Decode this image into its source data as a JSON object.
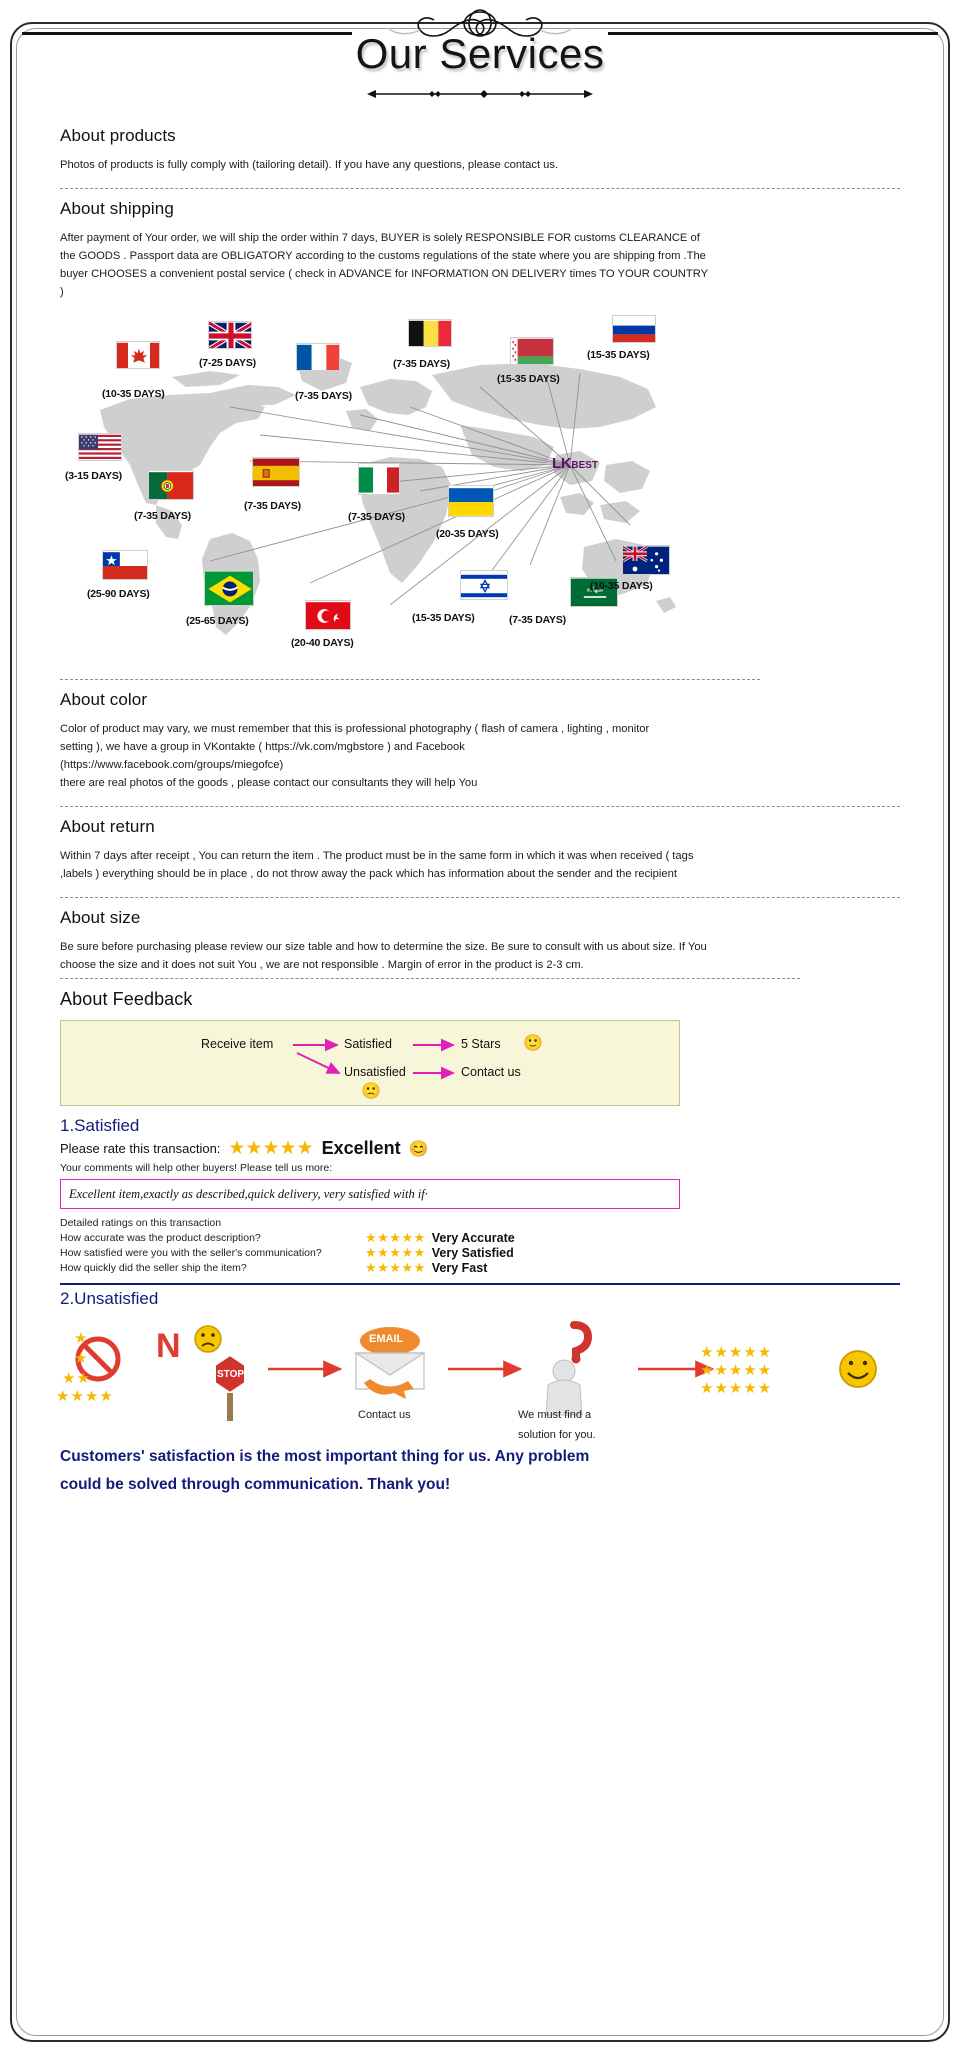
{
  "header": {
    "title": "Our Services",
    "flourish_icon": "ornamental-flourish-icon",
    "underline_icon": "decorative-divider-icon"
  },
  "sections": {
    "products": {
      "heading": "About products",
      "body": "Photos of products is fully comply with (tailoring detail). If you have any questions, please contact us."
    },
    "shipping": {
      "heading": "About shipping",
      "body": "After payment of Your order, we will ship the order within 7 days, BUYER is solely RESPONSIBLE FOR customs CLEARANCE of the GOODS . Passport data are OBLIGATORY according to the customs regulations of the state where you are shipping from .The buyer CHOOSES a convenient postal service ( check in ADVANCE for INFORMATION ON DELIVERY times TO YOUR COUNTRY )"
    },
    "color": {
      "heading": "About color",
      "body_line1": "Color of product may vary, we must remember that this is professional photography ( flash of camera , lighting , monitor",
      "body_line2": "setting ), we have a group in VKontakte ( https://vk.com/mgbstore ) and Facebook",
      "body_line3": "(https://www.facebook.com/groups/miegofce)",
      "body_line4": " there are real photos of the goods , please contact our consultants they will help You"
    },
    "return": {
      "heading": "About return",
      "body": "Within 7 days after receipt , You can return the item . The product must be in the same form in which it was when received ( tags ,labels ) everything should be in place , do not throw away the pack which has information about the sender and the recipient"
    },
    "size": {
      "heading": "About size",
      "body": "Be sure before purchasing  please review our size table and how to determine the size. Be sure to consult with us about size. If You choose the size and it does not suit You , we are not responsible . Margin of error in the product is 2-3 cm."
    },
    "feedback": {
      "heading": "About Feedback"
    }
  },
  "map": {
    "hub_label_main": "LK",
    "hub_label_sub": "BEST",
    "destinations": [
      {
        "country": "United Kingdom",
        "flag": "uk-flag",
        "days": "(7-25 DAYS)"
      },
      {
        "country": "Canada",
        "flag": "canada-flag",
        "days": "(10-35 DAYS)"
      },
      {
        "country": "France",
        "flag": "france-flag",
        "days": "(7-35 DAYS)"
      },
      {
        "country": "Belgium",
        "flag": "belgium-flag",
        "days": "(7-35 DAYS)"
      },
      {
        "country": "Belarus",
        "flag": "belarus-flag",
        "days": "(15-35 DAYS)"
      },
      {
        "country": "Russia",
        "flag": "russia-flag",
        "days": "(15-35 DAYS)"
      },
      {
        "country": "United States",
        "flag": "usa-flag",
        "days": "(3-15 DAYS)"
      },
      {
        "country": "Portugal",
        "flag": "portugal-flag",
        "days": "(7-35 DAYS)"
      },
      {
        "country": "Spain",
        "flag": "spain-flag",
        "days": "(7-35 DAYS)"
      },
      {
        "country": "Italy",
        "flag": "italy-flag",
        "days": "(7-35 DAYS)"
      },
      {
        "country": "Ukraine",
        "flag": "ukraine-flag",
        "days": "(20-35 DAYS)"
      },
      {
        "country": "Chile",
        "flag": "chile-flag",
        "days": "(25-90 DAYS)"
      },
      {
        "country": "Brazil",
        "flag": "brazil-flag",
        "days": "(25-65 DAYS)"
      },
      {
        "country": "Turkey",
        "flag": "turkey-flag",
        "days": "(20-40 DAYS)"
      },
      {
        "country": "Israel",
        "flag": "israel-flag",
        "days": "(15-35 DAYS)"
      },
      {
        "country": "Saudi Arabia",
        "flag": "saudi-arabia-flag",
        "days": "(7-35 DAYS)"
      },
      {
        "country": "Australia",
        "flag": "australia-flag",
        "days": "(10-35 DAYS)"
      }
    ]
  },
  "flow": {
    "receive_item": "Receive item",
    "satisfied": "Satisfied",
    "five_stars": "5 Stars",
    "unsatisfied": "Unsatisfied",
    "contact_us": "Contact us",
    "happy_face": "🙂",
    "sad_face": "🙁"
  },
  "satisfied_block": {
    "title": "1.Satisfied",
    "rate_prompt": "Please rate this transaction:",
    "stars": "★★★★★",
    "excellent": "Excellent",
    "smiley": "😊",
    "help_line": "Your comments will help other buyers! Please tell us more:",
    "comment": "Excellent item,exactly as described,quick delivery, very satisfied with if·",
    "detailed_head": "Detailed ratings on this transaction",
    "ratings": [
      {
        "question": "How accurate was the product description?",
        "stars": "★★★★★",
        "label": "Very Accurate"
      },
      {
        "question": "How satisfied were you with the seller's communication?",
        "stars": "★★★★★",
        "label": "Very Satisfied"
      },
      {
        "question": "How quickly did the seller ship the item?",
        "stars": "★★★★★",
        "label": "Very Fast"
      }
    ]
  },
  "unsatisfied_block": {
    "title": "2.Unsatisfied",
    "no_text": "N",
    "stop_text": "STOP",
    "email_text": "EMAIL",
    "contact_us": "Contact us",
    "find_solution_line1": "We must find a",
    "find_solution_line2": "solution for you.",
    "stars_row": "★★★★★",
    "smiley": "🙂",
    "sad_face": "🙁",
    "question_mark": "?"
  },
  "closing": {
    "line1": "Customers' satisfaction is the most important thing for us. Any problem",
    "line2": "could be solved through communication. Thank you!"
  },
  "colors": {
    "navy": "#121b7a",
    "gold": "#f6b800",
    "magenta": "#e020b8",
    "purple": "#5b1064",
    "map_gray": "#cfcfcf",
    "flow_bg": "#f8f6d8"
  }
}
